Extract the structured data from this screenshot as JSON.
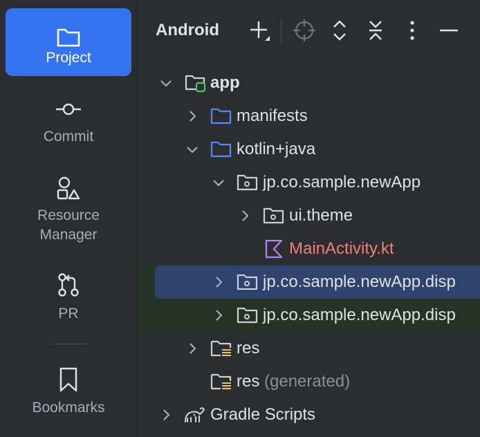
{
  "rail": {
    "items": [
      {
        "label": "Project",
        "icon": "folder-icon",
        "active": true
      },
      {
        "label": "Commit",
        "icon": "commit-icon",
        "active": false
      },
      {
        "label": "Resource\nManager",
        "label_line1": "Resource",
        "label_line2": "Manager",
        "icon": "shapes-icon",
        "active": false
      },
      {
        "label": "PR",
        "icon": "pull-request-icon",
        "active": false
      },
      {
        "label": "Bookmarks",
        "icon": "bookmark-icon",
        "active": false
      }
    ]
  },
  "panel": {
    "title": "Android",
    "toolbar": [
      "add-icon",
      "locate-icon",
      "expand-all-icon",
      "collapse-all-icon",
      "more-options-icon",
      "hide-icon"
    ]
  },
  "tree": {
    "rows": [
      {
        "label": "app",
        "icon": "module-icon",
        "expanded": true
      },
      {
        "label": "manifests",
        "icon": "folder-icon",
        "expanded": false
      },
      {
        "label": "kotlin+java",
        "icon": "folder-icon",
        "expanded": true
      },
      {
        "label": "jp.co.sample.newApp",
        "icon": "package-icon",
        "expanded": true
      },
      {
        "label": "ui.theme",
        "icon": "package-icon",
        "expanded": false
      },
      {
        "label": "MainActivity.kt",
        "icon": "kotlin-file-icon"
      },
      {
        "label": "jp.co.sample.newApp.disp",
        "icon": "package-icon",
        "expanded": false,
        "selected": true
      },
      {
        "label": "jp.co.sample.newApp.disp",
        "icon": "package-icon",
        "expanded": false
      },
      {
        "label": "res",
        "icon": "resource-folder-icon",
        "expanded": false
      },
      {
        "label": "res",
        "suffix": "(generated)",
        "icon": "resource-folder-icon"
      },
      {
        "label": "Gradle Scripts",
        "icon": "gradle-icon",
        "expanded": false
      }
    ]
  },
  "colors": {
    "accent": "#3574f0",
    "selection": "#2e436e",
    "changed_row": "#273227",
    "kotlin_file": "#f07f78",
    "module_badge": "#4fc66a"
  }
}
